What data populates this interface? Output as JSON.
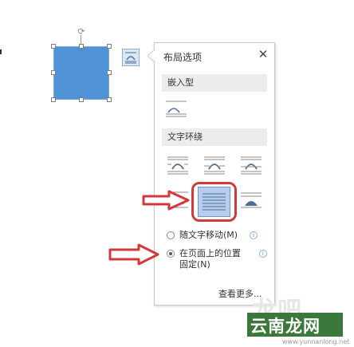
{
  "panel": {
    "title": "布局选项",
    "close_glyph": "✕",
    "sections": {
      "inline": "嵌入型",
      "wrap": "文字环绕"
    },
    "options": {
      "move_with_text": "随文字移动(M)",
      "fix_position_line1": "在页面上的位置",
      "fix_position_line2": "固定(N)",
      "selected": "fix_position"
    },
    "more_link": "查看更多..."
  },
  "icons": {
    "layout_button": "layout-options-icon",
    "rotate": "rotate-handle-icon",
    "info": "info-icon",
    "arrow": "red-arrow-icon"
  },
  "colors": {
    "shape_fill": "#4f93d6",
    "highlight": "#cf3b3b",
    "selected_option": "#b7cdea"
  },
  "watermark": {
    "text": "云南龙网",
    "url": "www.yunnanlong.net",
    "ghost": "龙吧"
  }
}
